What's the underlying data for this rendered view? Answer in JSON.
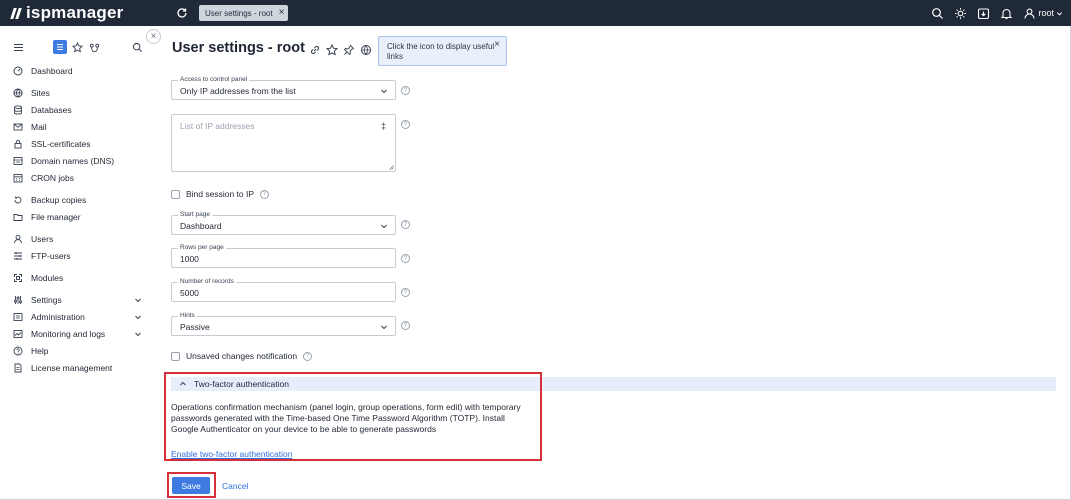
{
  "app": {
    "logo_text": "ispmanager",
    "tab_label": "User settings - root",
    "user_name": "root"
  },
  "sidebar": {
    "items": [
      {
        "label": "Dashboard",
        "icon": "dashboard-icon"
      },
      {
        "label": "Sites",
        "icon": "globe-icon"
      },
      {
        "label": "Databases",
        "icon": "database-icon"
      },
      {
        "label": "Mail",
        "icon": "mail-icon"
      },
      {
        "label": "SSL-certificates",
        "icon": "lock-icon"
      },
      {
        "label": "Domain names (DNS)",
        "icon": "dns-icon"
      },
      {
        "label": "CRON jobs",
        "icon": "calendar-icon"
      },
      {
        "label": "Backup copies",
        "icon": "backup-icon"
      },
      {
        "label": "File manager",
        "icon": "folder-icon"
      },
      {
        "label": "Users",
        "icon": "user-icon"
      },
      {
        "label": "FTP-users",
        "icon": "ftp-icon"
      },
      {
        "label": "Modules",
        "icon": "modules-icon"
      },
      {
        "label": "Settings",
        "icon": "sliders-icon"
      },
      {
        "label": "Administration",
        "icon": "admin-icon"
      },
      {
        "label": "Monitoring and logs",
        "icon": "monitoring-icon"
      },
      {
        "label": "Help",
        "icon": "help-icon"
      },
      {
        "label": "License management",
        "icon": "license-icon"
      }
    ]
  },
  "page": {
    "title": "User settings - root",
    "tooltip_text": "Click the icon to display useful links"
  },
  "form": {
    "access_label": "Access to control panel",
    "access_value": "Only IP addresses from the list",
    "ip_list_placeholder": "List of IP addresses",
    "bind_session_label": "Bind session to IP",
    "start_page_label": "Start page",
    "start_page_value": "Dashboard",
    "rows_per_page_label": "Rows per page",
    "rows_per_page_value": "1000",
    "records_label": "Number of records",
    "records_value": "5000",
    "hints_label": "Hints",
    "hints_value": "Passive",
    "unsaved_label": "Unsaved changes notification"
  },
  "twofa": {
    "header": "Two-factor authentication",
    "description": "Operations confirmation mechanism (panel login, group operations, form edit) with temporary passwords generated with the Time-based One Time Password Algorithm (TOTP). Install Google Authenticator on your device to be able to generate passwords",
    "link": "Enable two-factor authentication"
  },
  "actions": {
    "save": "Save",
    "cancel": "Cancel"
  },
  "colors": {
    "topbar": "#1f2937",
    "accent": "#3d7be0",
    "highlight_border": "#d6303b",
    "section_header": "#e6eefb"
  }
}
